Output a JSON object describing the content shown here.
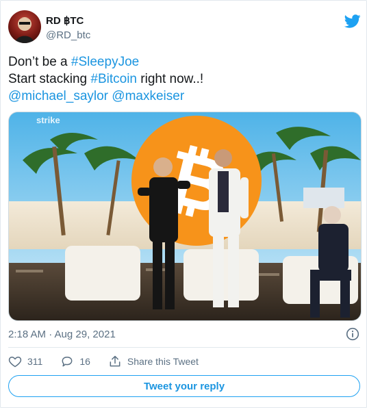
{
  "author": {
    "name": "RD ฿TC",
    "handle": "@RD_btc"
  },
  "tweet": {
    "lines": [
      [
        {
          "text": "Don’t be a ",
          "link": false
        },
        {
          "text": "#SleepyJoe",
          "link": true
        }
      ],
      [
        {
          "text": "Start stacking ",
          "link": false
        },
        {
          "text": "#Bitcoin",
          "link": true
        },
        {
          "text": " right now..!",
          "link": false
        }
      ],
      [
        {
          "text": "@michael_saylor",
          "link": true
        },
        {
          "text": " ",
          "link": false
        },
        {
          "text": "@maxkeiser",
          "link": true
        }
      ]
    ]
  },
  "media": {
    "watermark": "strike"
  },
  "timestamp": "2:18 AM · Aug 29, 2021",
  "actions": {
    "likes": "311",
    "replies": "16",
    "share_label": "Share this Tweet"
  },
  "reply_button": "Tweet your reply",
  "colors": {
    "link": "#1b95e0",
    "twitter_blue": "#1da1f2",
    "muted": "#5b7083",
    "bitcoin_orange": "#f7931a"
  },
  "icons": {
    "brand": "twitter-bird-icon",
    "info": "info-icon",
    "like": "heart-icon",
    "reply": "speech-bubble-icon",
    "share": "share-upload-icon"
  }
}
